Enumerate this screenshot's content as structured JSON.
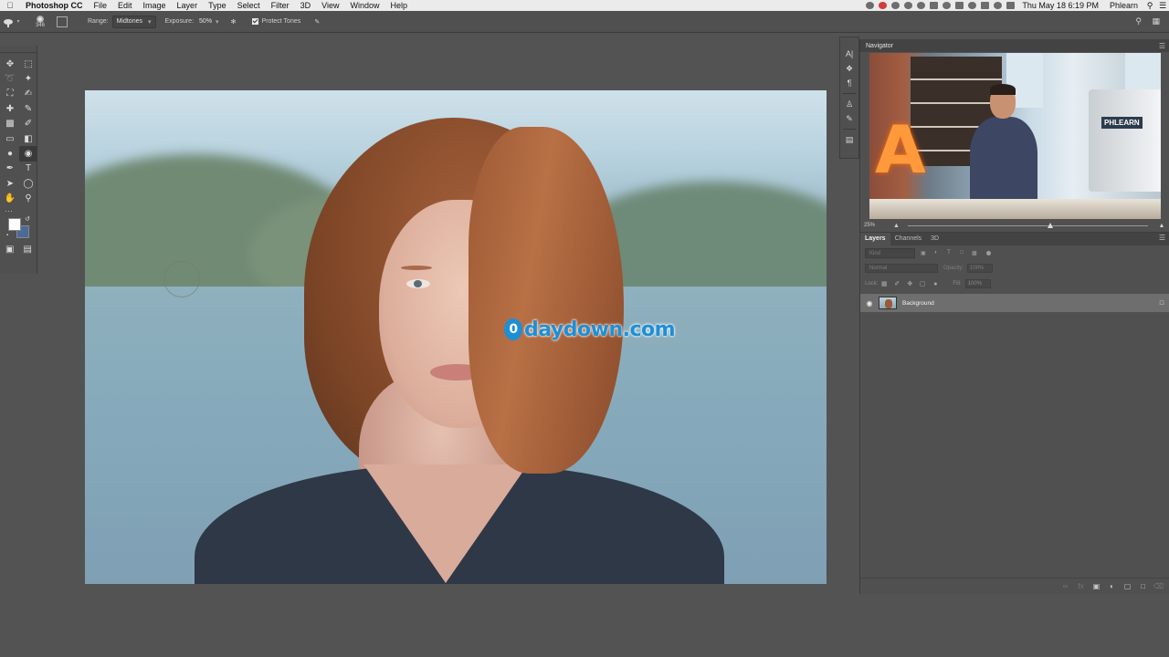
{
  "menubar": {
    "app_name": "Photoshop CC",
    "items": [
      "File",
      "Edit",
      "Image",
      "Layer",
      "Type",
      "Select",
      "Filter",
      "3D",
      "View",
      "Window",
      "Help"
    ],
    "clock": "Thu May 18  6:19 PM",
    "user": "Phlearn"
  },
  "options": {
    "brush_size": "346",
    "range_label": "Range:",
    "range_value": "Midtones",
    "exposure_label": "Exposure:",
    "exposure_value": "50%",
    "protect_tones_label": "Protect Tones",
    "protect_tones_checked": true
  },
  "toolbar": {
    "foreground_color": "#ffffff",
    "background_color": "#4a6a98",
    "active_tool": "dodge-tool"
  },
  "canvas": {
    "watermark_text": "daydown.com",
    "watermark_badge": "0",
    "watermark_color": "#1e8fd5"
  },
  "navigator": {
    "title": "Navigator",
    "zoom": "25%",
    "thumb_sign": "PHLEARN"
  },
  "layers": {
    "tabs": [
      "Layers",
      "Channels",
      "3D"
    ],
    "filter_placeholder": "Kind",
    "blend_mode": "Normal",
    "opacity_label": "Opacity:",
    "opacity_value": "100%",
    "lock_label": "Lock:",
    "fill_label": "Fill:",
    "fill_value": "100%",
    "layer_name": "Background"
  }
}
